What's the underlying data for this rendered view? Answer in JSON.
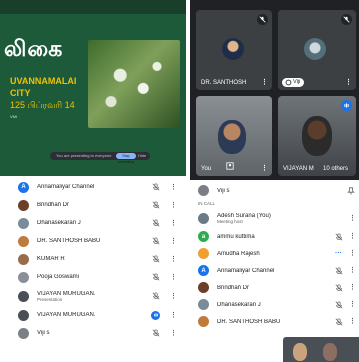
{
  "slide": {
    "title": "லிகை",
    "line1": "UVANNAMALAI",
    "line2": "CITY",
    "line3": "125 பிப்ரவரி 14",
    "line4": "VMI",
    "presenting_text": "You are presenting to everyone",
    "present_button": "Stop presenting",
    "bar_more": "Hide"
  },
  "left_participants": [
    {
      "name": "Annamaliyar Channel",
      "sub": "",
      "avatar_color": "#1a73e8",
      "avatar_letter": "A",
      "mic": "off"
    },
    {
      "name": "Brindhaň Dr",
      "sub": "",
      "avatar_color": "#6b3f2a",
      "avatar_letter": "",
      "mic": "off"
    },
    {
      "name": "Dhanasekaran J",
      "sub": "",
      "avatar_color": "#7a8b99",
      "avatar_letter": "",
      "mic": "off"
    },
    {
      "name": "DR. SANTHOSH BABU",
      "sub": "",
      "avatar_color": "#c07a3a",
      "avatar_letter": "",
      "mic": "off"
    },
    {
      "name": "KUMAR R",
      "sub": "",
      "avatar_color": "#9a6b4a",
      "avatar_letter": "",
      "mic": "off"
    },
    {
      "name": "Pooja Goswami",
      "sub": "",
      "avatar_color": "#8a8f96",
      "avatar_letter": "",
      "mic": "off"
    },
    {
      "name": "VIJAYAN MURUGAN.",
      "sub": "Presentation",
      "avatar_color": "#4a4f55",
      "avatar_letter": "",
      "mic": "off"
    },
    {
      "name": "VIJAYAN MURUGAN.",
      "sub": "",
      "avatar_color": "#4a4f55",
      "avatar_letter": "",
      "mic": "on"
    },
    {
      "name": "Viji s",
      "sub": "",
      "avatar_color": "#7a7f86",
      "avatar_letter": "",
      "mic": "off"
    }
  ],
  "tiles": {
    "santhosh": "DR. SANTHOSH",
    "viji": "Viji",
    "you": "You",
    "vijayan": "VIJAYAN M",
    "others": "10 others"
  },
  "right_panel": {
    "top_name": "Viji s",
    "section": "IN CALL",
    "people": [
      {
        "name": "Adesh Surana (You)",
        "sub": "Meeting host",
        "avatar_color": "#6b7a88",
        "avatar_letter": "",
        "mic": "none"
      },
      {
        "name": "ammu kuttima",
        "sub": "",
        "avatar_color": "#34a853",
        "avatar_letter": "a",
        "mic": "off"
      },
      {
        "name": "Amudha Rajesh",
        "sub": "",
        "avatar_color": "#f0a030",
        "avatar_letter": "",
        "mic": "speaking"
      },
      {
        "name": "Annamaliyar Channel",
        "sub": "",
        "avatar_color": "#1a73e8",
        "avatar_letter": "A",
        "mic": "off"
      },
      {
        "name": "Brindhaň Dr",
        "sub": "",
        "avatar_color": "#6b3f2a",
        "avatar_letter": "",
        "mic": "off"
      },
      {
        "name": "Dhanasekaran J",
        "sub": "",
        "avatar_color": "#7a8b99",
        "avatar_letter": "",
        "mic": "off"
      },
      {
        "name": "DR. SANTHOSH BABU",
        "sub": "",
        "avatar_color": "#c07a3a",
        "avatar_letter": "",
        "mic": "off"
      }
    ]
  }
}
